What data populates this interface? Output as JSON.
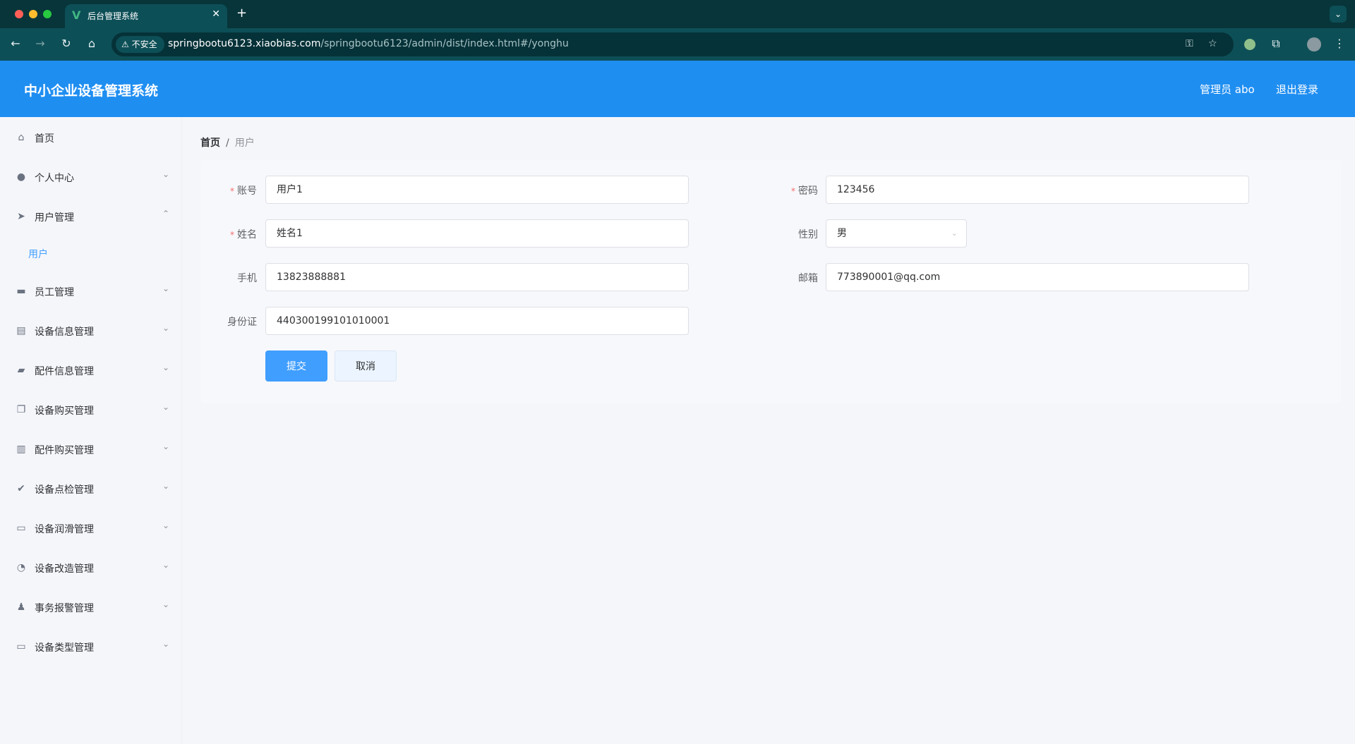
{
  "browser": {
    "tab_title": "后台管理系统",
    "tab_close": "✕",
    "new_tab": "+",
    "insecure_label": "不安全",
    "url_host": "springbootu6123.xiaobias.com",
    "url_path": "/springbootu6123/admin/dist/index.html#/yonghu"
  },
  "header": {
    "title": "中小企业设备管理系统",
    "user": "管理员 abo",
    "logout": "退出登录"
  },
  "sidebar": {
    "items": [
      {
        "label": "首页",
        "icon": "home-icon"
      },
      {
        "label": "个人中心",
        "icon": "user-icon"
      },
      {
        "label": "用户管理",
        "icon": "send-icon",
        "expanded": true
      },
      {
        "label": "员工管理",
        "icon": "monitor-icon"
      },
      {
        "label": "设备信息管理",
        "icon": "clipboard-icon"
      },
      {
        "label": "配件信息管理",
        "icon": "wallet-icon"
      },
      {
        "label": "设备购买管理",
        "icon": "copy-icon"
      },
      {
        "label": "配件购买管理",
        "icon": "bar-chart-icon"
      },
      {
        "label": "设备点检管理",
        "icon": "check-clipboard-icon"
      },
      {
        "label": "设备润滑管理",
        "icon": "message-icon"
      },
      {
        "label": "设备改造管理",
        "icon": "compass-icon"
      },
      {
        "label": "事务报警管理",
        "icon": "person-icon"
      },
      {
        "label": "设备类型管理",
        "icon": "card-icon"
      }
    ],
    "sub_item": "用户"
  },
  "breadcrumb": {
    "home": "首页",
    "separator": "/",
    "current": "用户"
  },
  "form": {
    "account_label": "账号",
    "account_value": "用户1",
    "password_label": "密码",
    "password_value": "123456",
    "name_label": "姓名",
    "name_value": "姓名1",
    "gender_label": "性别",
    "gender_value": "男",
    "phone_label": "手机",
    "phone_value": "13823888881",
    "email_label": "邮箱",
    "email_value": "773890001@qq.com",
    "idcard_label": "身份证",
    "idcard_value": "440300199101010001",
    "required_mark": "*",
    "submit": "提交",
    "cancel": "取消"
  },
  "colors": {
    "header_bg": "#1f8ef1",
    "primary": "#409eff",
    "required": "#f56c6c"
  }
}
